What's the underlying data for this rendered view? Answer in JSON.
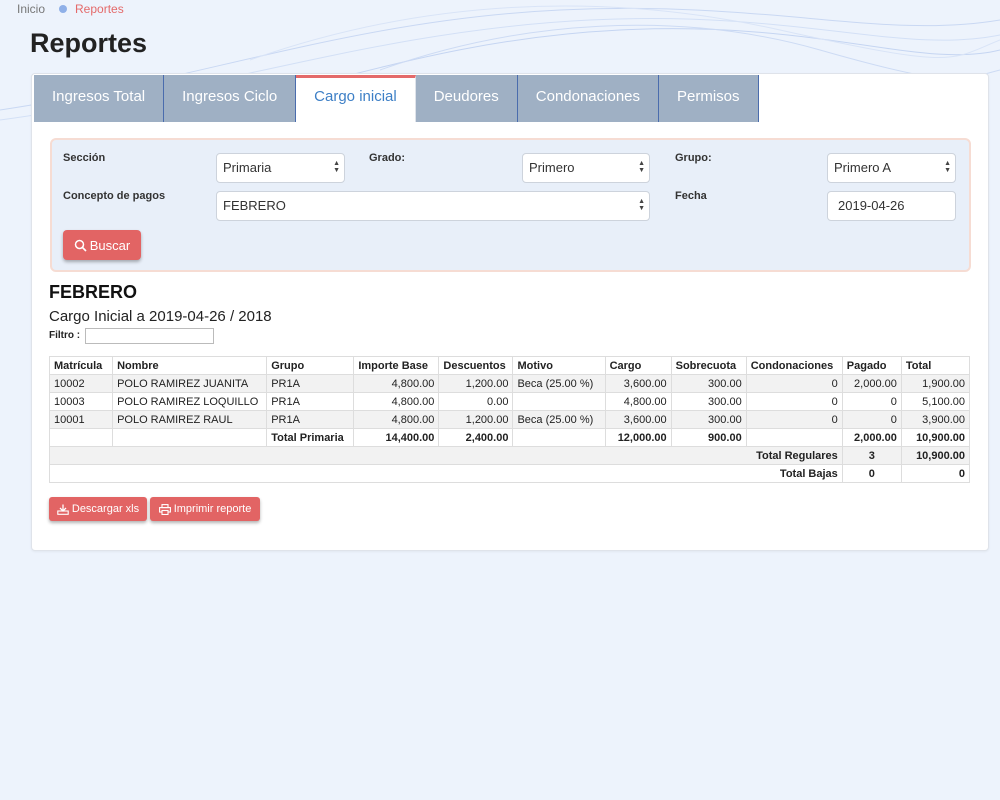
{
  "breadcrumb": {
    "home": "Inicio",
    "current": "Reportes"
  },
  "page": {
    "title": "Reportes"
  },
  "tabs": [
    {
      "label": "Ingresos Total",
      "active": false
    },
    {
      "label": "Ingresos Ciclo",
      "active": false
    },
    {
      "label": "Cargo inicial",
      "active": true
    },
    {
      "label": "Deudores",
      "active": false
    },
    {
      "label": "Condonaciones",
      "active": false
    },
    {
      "label": "Permisos",
      "active": false
    }
  ],
  "filters": {
    "seccion": {
      "label": "Sección",
      "value": "Primaria"
    },
    "grado": {
      "label": "Grado:",
      "value": "Primero"
    },
    "grupo": {
      "label": "Grupo:",
      "value": "Primero A"
    },
    "concepto": {
      "label": "Concepto de pagos",
      "value": "FEBRERO"
    },
    "fecha": {
      "label": "Fecha",
      "value": "2019-04-26"
    },
    "buscar_label": "Buscar"
  },
  "report": {
    "title": "FEBRERO",
    "subtitle": "Cargo Inicial a 2019-04-26 / 2018",
    "filtro_label": "Filtro :",
    "filtro_value": "",
    "columns": [
      "Matrícula",
      "Nombre",
      "Grupo",
      "Importe Base",
      "Descuentos",
      "Motivo",
      "Cargo",
      "Sobrecuota",
      "Condonaciones",
      "Pagado",
      "Total"
    ],
    "rows": [
      [
        "10002",
        "POLO RAMIREZ JUANITA",
        "PR1A",
        "4,800.00",
        "1,200.00",
        "Beca (25.00 %)",
        "3,600.00",
        "300.00",
        "0",
        "2,000.00",
        "1,900.00"
      ],
      [
        "10003",
        "POLO RAMIREZ LOQUILLO",
        "PR1A",
        "4,800.00",
        "0.00",
        "",
        "4,800.00",
        "300.00",
        "0",
        "0",
        "5,100.00"
      ],
      [
        "10001",
        "POLO RAMIREZ RAUL",
        "PR1A",
        "4,800.00",
        "1,200.00",
        "Beca (25.00 %)",
        "3,600.00",
        "300.00",
        "0",
        "0",
        "3,900.00"
      ]
    ],
    "total_primaria": {
      "label": "Total Primaria",
      "importe_base": "14,400.00",
      "descuentos": "2,400.00",
      "cargo": "12,000.00",
      "sobrecuota": "900.00",
      "pagado": "2,000.00",
      "total": "10,900.00"
    },
    "total_regulares": {
      "label": "Total Regulares",
      "count": "3",
      "total": "10,900.00"
    },
    "total_bajas": {
      "label": "Total Bajas",
      "count": "0",
      "total": "0"
    }
  },
  "actions": {
    "descargar": "Descargar xls",
    "imprimir": "Imprimir reporte"
  },
  "colors": {
    "accent": "#e26464",
    "tab_inactive": "#9fb0c4",
    "tab_active_text": "#3d7fc6",
    "panel_bg": "#e8eff9",
    "page_bg": "#edf3fc"
  }
}
